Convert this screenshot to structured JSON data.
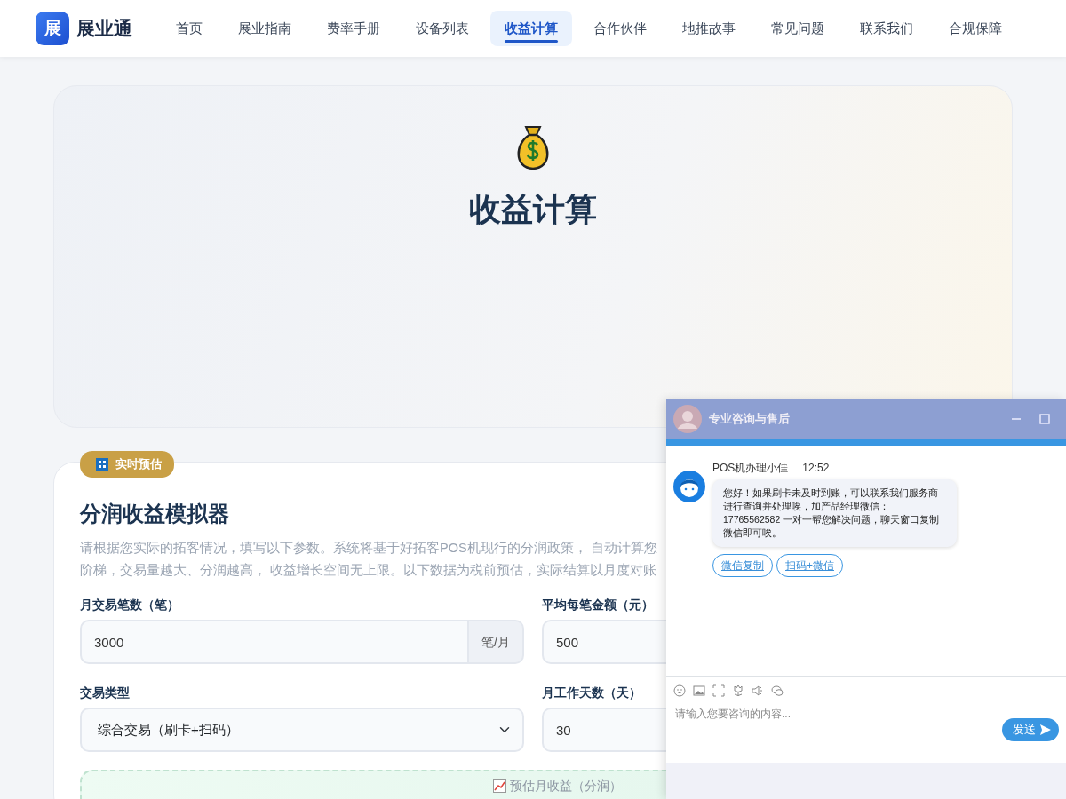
{
  "brand": {
    "logo": "展",
    "name": "展业通"
  },
  "nav": [
    {
      "label": "首页",
      "selected": false
    },
    {
      "label": "展业指南",
      "selected": false
    },
    {
      "label": "费率手册",
      "selected": false
    },
    {
      "label": "设备列表",
      "selected": false
    },
    {
      "label": "收益计算",
      "selected": true
    },
    {
      "label": "合作伙伴",
      "selected": false
    },
    {
      "label": "地推故事",
      "selected": false
    },
    {
      "label": "常见问题",
      "selected": false
    },
    {
      "label": "联系我们",
      "selected": false
    },
    {
      "label": "合规保障",
      "selected": false
    }
  ],
  "hero": {
    "title": "收益计算"
  },
  "calculator": {
    "badge": "实时预估",
    "title": "分润收益模拟器",
    "description_lines": [
      "请根据您实际的拓客情况，填写以下参数。系统将基于好拓客POS机现行的分润政策， 自动计算您",
      "阶梯，交易量越大、分润越高， 收益增长空间无上限。以下数据为税前预估，实际结算以月度对账"
    ],
    "fields": [
      {
        "label": "月交易笔数（笔）",
        "kind": "input",
        "value": "3000",
        "suffix": "笔/月"
      },
      {
        "label": "平均每笔金额（元）",
        "kind": "input",
        "value": "500"
      },
      {
        "label": "交易类型",
        "kind": "select",
        "value": "综合交易（刷卡+扫码）"
      },
      {
        "label": "月工作天数（天）",
        "kind": "input",
        "value": "30"
      }
    ],
    "result": {
      "label": "预估月收益（分润）"
    }
  },
  "chat": {
    "title": "专业咨询与售后",
    "agent": "POS机办理小佳",
    "time": "12:52",
    "message": "您好！如果刷卡未及时到账，可以联系我们服务商进行查询并处理唉，加产品经理微信：17765562582 一对一帮您解决问题，聊天窗口复制微信即可唉。",
    "actions": [
      "微信复制",
      "扫码+微信"
    ],
    "input": {
      "placeholder": "请输入您要咨询的内容..."
    },
    "send": "发送"
  }
}
